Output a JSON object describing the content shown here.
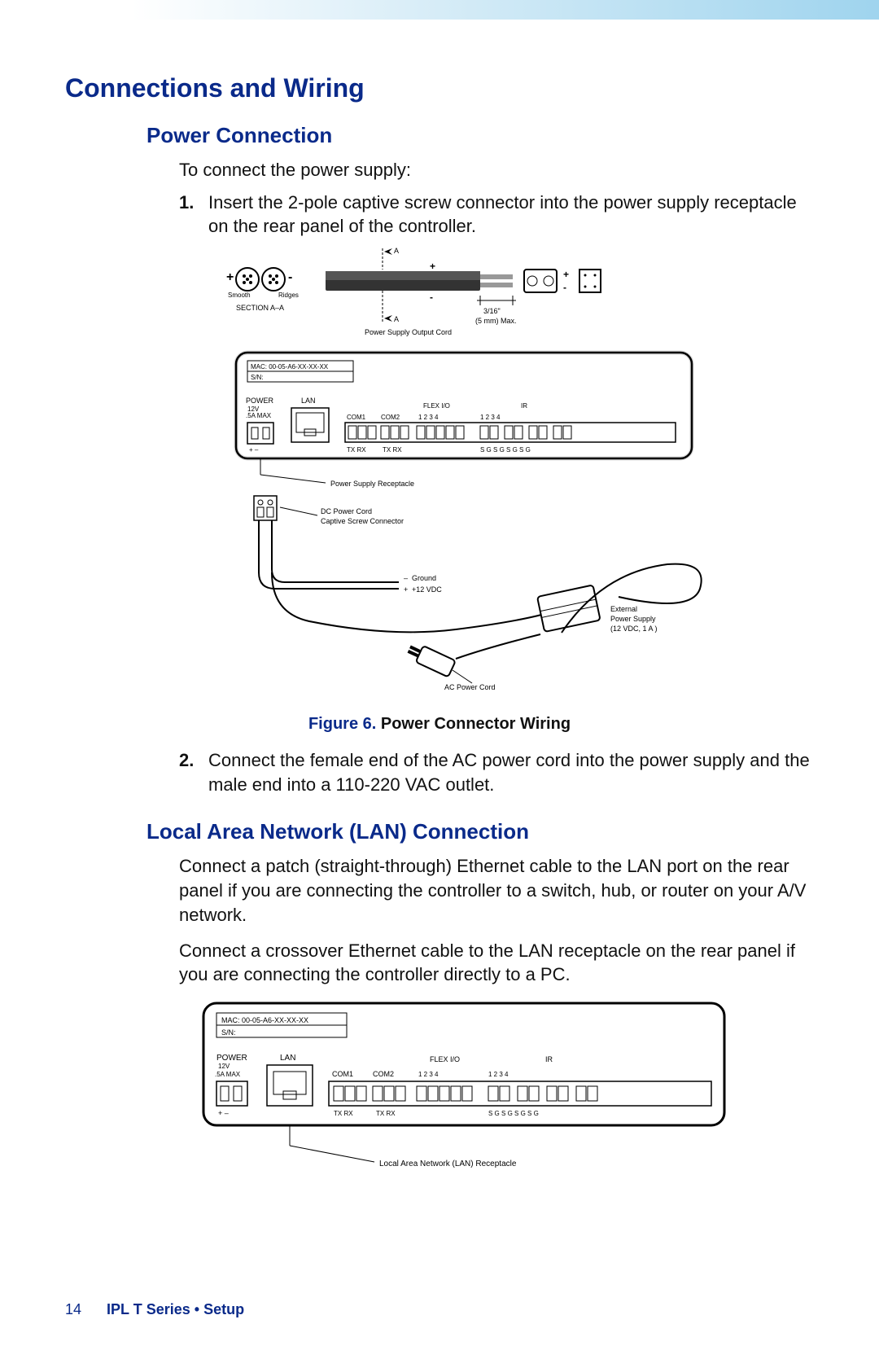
{
  "header": {
    "title": "Connections and Wiring"
  },
  "section1": {
    "title": "Power Connection",
    "intro": "To connect the power supply:",
    "steps": {
      "s1_num": "1.",
      "s1_text": "Insert the 2-pole captive screw connector into the power supply receptacle on the rear panel of the controller.",
      "s2_num": "2.",
      "s2_text": "Connect the female end of the AC power cord into the power supply and the male end into a 110-220 VAC outlet."
    },
    "figure": {
      "label": "Figure 6.",
      "text": " Power Connector Wiring"
    }
  },
  "diagram1_labels": {
    "a_top": "A",
    "a_bottom": "A",
    "smooth": "Smooth",
    "ridges": "Ridges",
    "section": "SECTION  A–A",
    "plus": "+",
    "minus": "-",
    "dim1": "3/16\"",
    "dim2": "(5 mm) Max.",
    "pso": "Power Supply Output Cord",
    "mac": "MAC: 00-05-A6-XX-XX-XX",
    "sn": "S/N:",
    "power": "POWER",
    "v12": "12V",
    "amp": ".5A MAX",
    "lan": "LAN",
    "com1": "COM1",
    "com2": "COM2",
    "flexio": "FLEX I/O",
    "ir": "IR",
    "n1": "1",
    "n2": "2",
    "n3": "3",
    "n4": "4",
    "txrx": "TX RX",
    "sg": "S  G  S  G  S  G  S  G",
    "psr": "Power Supply Receptacle",
    "dcc": "DC Power Cord",
    "csc": "Captive Screw Connector",
    "ground": "Ground",
    "vdc12": "+12 VDC",
    "ext1": "External",
    "ext2": "Power Supply",
    "ext3": "(12 VDC, 1 A )",
    "acpc": "AC Power Cord"
  },
  "section2": {
    "title": "Local Area Network (LAN) Connection",
    "p1": "Connect a patch (straight-through) Ethernet cable to the LAN port on the rear panel if you are connecting the controller to a switch, hub, or router on your A/V network.",
    "p2": "Connect a crossover Ethernet cable to the LAN receptacle on the rear panel if you are connecting the controller directly to a PC."
  },
  "diagram2_labels": {
    "lanr": "Local Area Network (LAN) Receptacle"
  },
  "footer": {
    "page_num": "14",
    "doc_ref": "IPL T Series • Setup"
  }
}
